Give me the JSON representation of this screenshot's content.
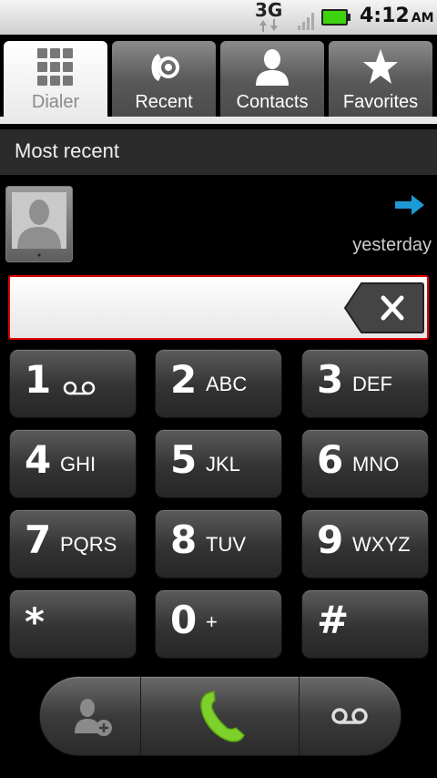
{
  "status": {
    "network": "3G",
    "time": "4:12",
    "ampm": "AM"
  },
  "tabs": [
    {
      "label": "Dialer",
      "icon": "dialpad-grid-icon",
      "active": true
    },
    {
      "label": "Recent",
      "icon": "call-log-icon",
      "active": false
    },
    {
      "label": "Contacts",
      "icon": "person-icon",
      "active": false
    },
    {
      "label": "Favorites",
      "icon": "star-icon",
      "active": false
    }
  ],
  "recent": {
    "header": "Most recent",
    "when": "yesterday"
  },
  "number_field": {
    "value": ""
  },
  "keys": [
    {
      "digit": "1",
      "letters": ""
    },
    {
      "digit": "2",
      "letters": "ABC"
    },
    {
      "digit": "3",
      "letters": "DEF"
    },
    {
      "digit": "4",
      "letters": "GHI"
    },
    {
      "digit": "5",
      "letters": "JKL"
    },
    {
      "digit": "6",
      "letters": "MNO"
    },
    {
      "digit": "7",
      "letters": "PQRS"
    },
    {
      "digit": "8",
      "letters": "TUV"
    },
    {
      "digit": "9",
      "letters": "WXYZ"
    },
    {
      "digit": "*",
      "letters": ""
    },
    {
      "digit": "0",
      "letters": "+"
    },
    {
      "digit": "#",
      "letters": ""
    }
  ],
  "colors": {
    "accent_call": "#7dd12b",
    "arrow_blue": "#1d9ad6",
    "field_border": "#dd0000"
  }
}
